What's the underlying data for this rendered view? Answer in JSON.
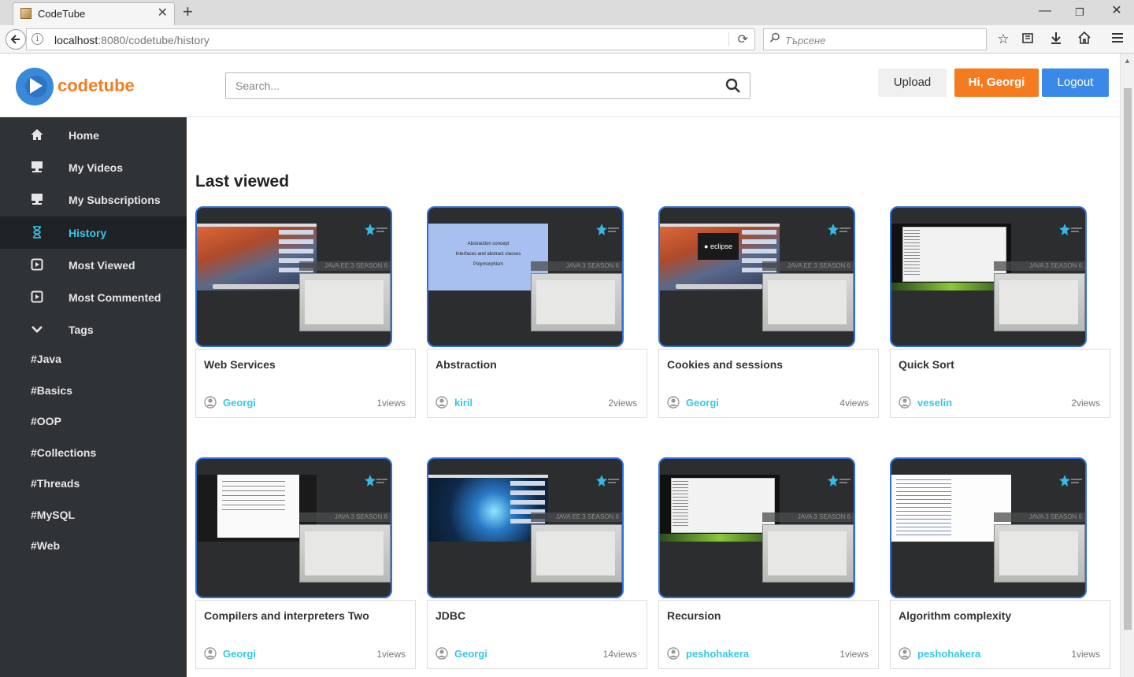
{
  "browser": {
    "tab_title": "CodeTube",
    "tab_close": "✕",
    "new_tab": "+",
    "url_host": "localhost",
    "url_rest": ":8080/codetube/history",
    "search_placeholder": "Търсене",
    "window_controls": {
      "minimize": "—",
      "maximize": "❐",
      "close": "✕"
    }
  },
  "header": {
    "logo_text": "codetube",
    "search_placeholder": "Search...",
    "upload_label": "Upload",
    "greeting_label": "Hi, Georgi",
    "logout_label": "Logout",
    "colors": {
      "brand_orange": "#f47b20",
      "accent_blue": "#3a89e8",
      "accent_cyan": "#36c8e8"
    }
  },
  "sidebar": {
    "items": [
      {
        "label": "Home",
        "icon": "home-icon",
        "active": false
      },
      {
        "label": "My Videos",
        "icon": "monitor-icon",
        "active": false
      },
      {
        "label": "My Subscriptions",
        "icon": "monitor-icon",
        "active": false
      },
      {
        "label": "History",
        "icon": "hourglass-icon",
        "active": true
      },
      {
        "label": "Most Viewed",
        "icon": "play-square-icon",
        "active": false
      },
      {
        "label": "Most Commented",
        "icon": "play-square-icon",
        "active": false
      },
      {
        "label": "Tags",
        "icon": "chevron-down-icon",
        "active": false
      }
    ],
    "tags": [
      "#Java",
      "#Basics",
      "#OOP",
      "#Collections",
      "#Threads",
      "#MySQL",
      "#Web"
    ]
  },
  "main": {
    "title": "Last viewed",
    "videos": [
      {
        "title": "Web Services",
        "user": "Georgi",
        "views": "1views",
        "strip": "JAVA EE 3 SEASON 6",
        "screen": "mac"
      },
      {
        "title": "Abstraction",
        "user": "kiril",
        "views": "2views",
        "strip": "JAVA 3 SEASON 6",
        "screen": "slide-blue"
      },
      {
        "title": "Cookies and sessions",
        "user": "Georgi",
        "views": "4views",
        "strip": "JAVA EE 3 SEASON 6",
        "screen": "mac-eclipse"
      },
      {
        "title": "Quick Sort",
        "user": "veselin",
        "views": "2views",
        "strip": "JAVA 3 SEASON 6",
        "screen": "ide"
      },
      {
        "title": "Compilers and interpreters Two",
        "user": "Georgi",
        "views": "1views",
        "strip": "JAVA 3 SEASON 6",
        "screen": "slide-white"
      },
      {
        "title": "JDBC",
        "user": "Georgi",
        "views": "14views",
        "strip": "JAVA EE 3 SEASON 6",
        "screen": "game"
      },
      {
        "title": "Recursion",
        "user": "peshohakera",
        "views": "1views",
        "strip": "JAVA 3 SEASON 6",
        "screen": "ide"
      },
      {
        "title": "Algorithm complexity",
        "user": "peshohakera",
        "views": "1views",
        "strip": "JAVA 3 SEASON 6",
        "screen": "code"
      }
    ]
  }
}
